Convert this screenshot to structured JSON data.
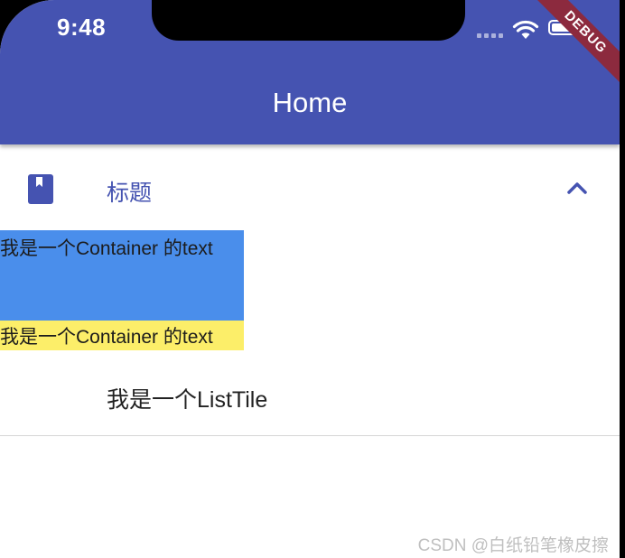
{
  "status_bar": {
    "time": "9:48",
    "signal_icon": "signal-dots-icon",
    "wifi_icon": "wifi-icon",
    "battery_icon": "battery-icon"
  },
  "debug_banner": "DEBUG",
  "app_bar": {
    "title": "Home",
    "color": "#4553b1"
  },
  "expansion_tile": {
    "leading_icon": "book-icon",
    "title": "标题",
    "trailing_icon": "chevron-up-icon",
    "accent_color": "#4553b1"
  },
  "containers": [
    {
      "text": "我是一个Container 的text",
      "color": "#4a8eeb"
    },
    {
      "text": "我是一个Container 的text",
      "color": "#fcee69"
    }
  ],
  "list_tile": {
    "title": "我是一个ListTile"
  },
  "watermark": "CSDN @白纸铅笔橡皮擦"
}
